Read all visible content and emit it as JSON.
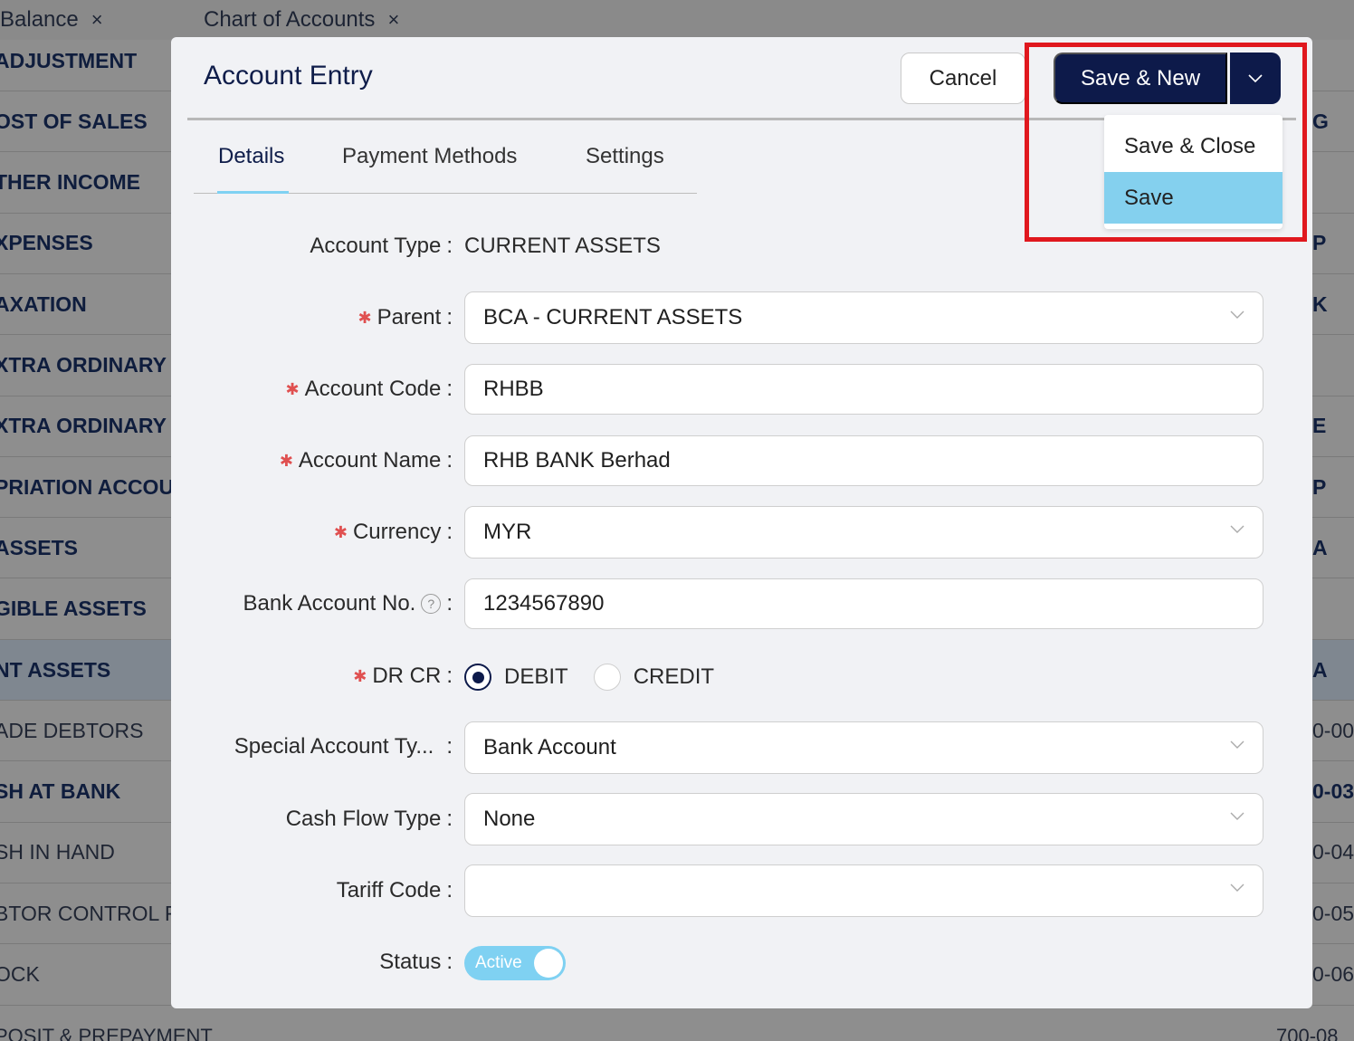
{
  "background": {
    "tabs": [
      {
        "label": "Balance",
        "close": "×"
      },
      {
        "label": "Chart of Accounts",
        "close": "×"
      }
    ],
    "left_rows": [
      {
        "text": "ADJUSTMENT",
        "style": "bold"
      },
      {
        "text": "OST OF SALES",
        "style": "bold"
      },
      {
        "text": "THER INCOME",
        "style": "bold"
      },
      {
        "text": "XPENSES",
        "style": "bold"
      },
      {
        "text": "AXATION",
        "style": "bold"
      },
      {
        "text": "XTRA ORDINARY",
        "style": "bold"
      },
      {
        "text": "XTRA ORDINARY",
        "style": "bold"
      },
      {
        "text": "PRIATION ACCOU",
        "style": "bold"
      },
      {
        "text": "ASSETS",
        "style": "bold"
      },
      {
        "text": "GIBLE ASSETS",
        "style": "bold"
      },
      {
        "text": "NT ASSETS",
        "style": "bold",
        "selected": true
      },
      {
        "text": "ADE DEBTORS",
        "style": "normal"
      },
      {
        "text": "SH AT BANK",
        "style": "bold"
      },
      {
        "text": "SH IN HAND",
        "style": "normal"
      },
      {
        "text": "BTOR CONTROL F",
        "style": "normal"
      },
      {
        "text": "OCK",
        "style": "normal"
      }
    ],
    "right_rows": [
      {
        "text": "",
        "style": "bold"
      },
      {
        "text": "G",
        "style": "bold"
      },
      {
        "text": "",
        "style": "bold"
      },
      {
        "text": "P",
        "style": "bold"
      },
      {
        "text": "K",
        "style": "bold"
      },
      {
        "text": "",
        "style": "bold"
      },
      {
        "text": "E",
        "style": "bold"
      },
      {
        "text": "P",
        "style": "bold"
      },
      {
        "text": "A",
        "style": "bold"
      },
      {
        "text": "",
        "style": "bold"
      },
      {
        "text": "A",
        "style": "bold",
        "selected": true
      },
      {
        "text": "0-00",
        "style": "normal"
      },
      {
        "text": "0-03",
        "style": "bold"
      },
      {
        "text": "0-04",
        "style": "normal"
      },
      {
        "text": "0-05",
        "style": "normal"
      },
      {
        "text": "0-06",
        "style": "normal"
      }
    ],
    "bottom_left": "POSIT & PREPAYMENT",
    "bottom_right": "700-08"
  },
  "modal": {
    "title": "Account Entry",
    "cancel_label": "Cancel",
    "save_new_label": "Save & New",
    "dropdown": {
      "items": [
        "Save & Close",
        "Save"
      ],
      "active_index": 1
    },
    "tabs": [
      "Details",
      "Payment Methods",
      "Settings"
    ],
    "active_tab": "Details",
    "form": {
      "account_type_label": "Account Type",
      "account_type_value": "CURRENT ASSETS",
      "parent_label": "Parent",
      "parent_value": "BCA - CURRENT ASSETS",
      "account_code_label": "Account Code",
      "account_code_value": "RHBB",
      "account_name_label": "Account Name",
      "account_name_value": "RHB BANK Berhad",
      "currency_label": "Currency",
      "currency_value": "MYR",
      "bank_account_label": "Bank Account No.",
      "bank_account_value": "1234567890",
      "drcr_label": "DR CR",
      "drcr_options": [
        "DEBIT",
        "CREDIT"
      ],
      "drcr_selected": "DEBIT",
      "special_type_label": "Special Account Ty...",
      "special_type_value": "Bank Account",
      "cash_flow_label": "Cash Flow Type",
      "cash_flow_value": "None",
      "tariff_label": "Tariff Code",
      "tariff_value": "",
      "status_label": "Status",
      "status_value": "Active"
    },
    "colors": {
      "primary": "#0d1a4a",
      "accent": "#7fd1f2",
      "highlight": "#e0181e",
      "required": "#e05050"
    }
  }
}
